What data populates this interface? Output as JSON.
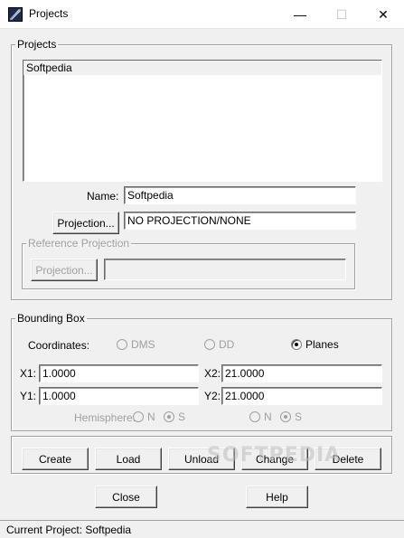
{
  "window": {
    "title": "Projects",
    "min_glyph": "—",
    "max_glyph": "☐",
    "close_glyph": "✕"
  },
  "projects_group": {
    "legend": "Projects",
    "list_items": [
      "Softpedia"
    ],
    "name_label": "Name:",
    "name_value": "Softpedia",
    "projection_button": "Projection...",
    "projection_value": "NO PROJECTION/NONE",
    "reference": {
      "legend": "Reference Projection",
      "projection_button": "Projection...",
      "value": ""
    }
  },
  "bounding_box": {
    "legend": "Bounding Box",
    "coordinates_label": "Coordinates:",
    "options": [
      {
        "label": "DMS",
        "checked": false,
        "enabled": false
      },
      {
        "label": "DD",
        "checked": false,
        "enabled": false
      },
      {
        "label": "Planes",
        "checked": true,
        "enabled": true
      }
    ],
    "x1_label": "X1:",
    "x1_value": "1.0000",
    "x2_label": "X2:",
    "x2_value": "21.0000",
    "y1_label": "Y1:",
    "y1_value": "1.0000",
    "y2_label": "Y2:",
    "y2_value": "21.0000",
    "hemisphere_label": "Hemisphere:",
    "hemi_left": [
      {
        "label": "N",
        "checked": false
      },
      {
        "label": "S",
        "checked": true
      }
    ],
    "hemi_right": [
      {
        "label": "N",
        "checked": false
      },
      {
        "label": "S",
        "checked": true
      }
    ]
  },
  "actions": {
    "create": "Create",
    "load": "Load",
    "unload": "Unload",
    "change": "Change",
    "delete": "Delete",
    "close": "Close",
    "help": "Help"
  },
  "status": {
    "text": "Current Project: Softpedia"
  },
  "watermark": "SOFTPEDIA",
  "icons": {
    "app": "projects-app-icon"
  }
}
